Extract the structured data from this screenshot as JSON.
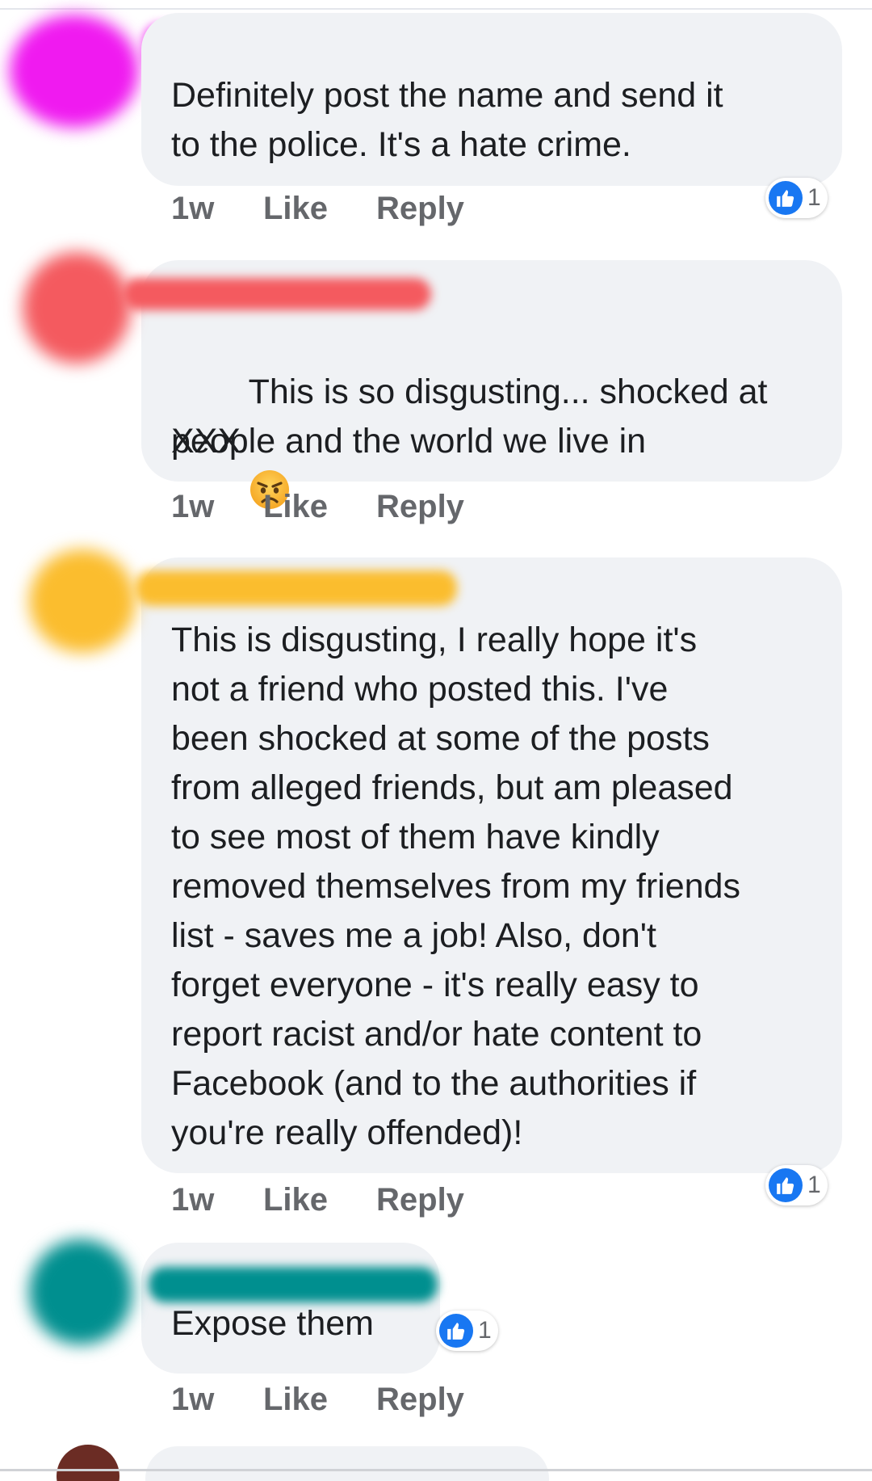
{
  "comments": [
    {
      "text": "Definitely post the name and send it\nto the police. It's a hate crime.",
      "time": "1w",
      "like_label": "Like",
      "reply_label": "Reply",
      "reaction_icon": "thumbs-up-icon",
      "reaction_count": "1",
      "scribble_color": "#f01af0"
    },
    {
      "text": "This is so disgusting... shocked at\npeople and the world we live in",
      "text_line3": "XXX",
      "emoji": "angry-face-icon",
      "time": "1w",
      "like_label": "Like",
      "reply_label": "Reply",
      "scribble_color": "#f45a5f"
    },
    {
      "text": "This is disgusting, I really hope it's\nnot a friend who posted this. I've\nbeen shocked at some of the posts\nfrom alleged friends, but am pleased\nto see most of them have kindly\nremoved themselves from my friends\nlist - saves me a job! Also, don't\nforget everyone - it's really easy to\nreport racist and/or hate content to\nFacebook (and to the authorities if\nyou're really offended)!",
      "time": "1w",
      "like_label": "Like",
      "reply_label": "Reply",
      "reaction_icon": "thumbs-up-icon",
      "reaction_count": "1",
      "scribble_color": "#fbbd2e"
    },
    {
      "text": "Expose them",
      "time": "1w",
      "like_label": "Like",
      "reply_label": "Reply",
      "reaction_icon": "thumbs-up-icon",
      "reaction_count": "1",
      "scribble_color": "#008f8f"
    }
  ],
  "colors": {
    "bubble": "#f0f2f5",
    "meta_text": "#65676b",
    "like_blue": "#1877f2"
  }
}
